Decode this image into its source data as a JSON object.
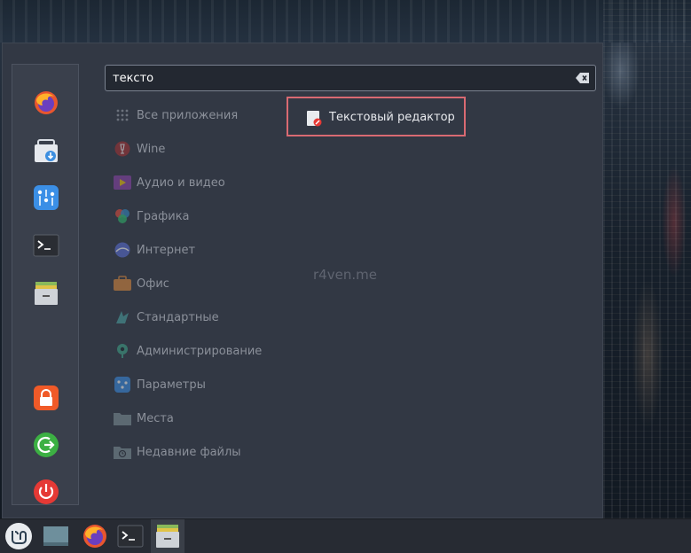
{
  "search": {
    "value": "тексто",
    "placeholder": ""
  },
  "categories": [
    {
      "label": "Все приложения",
      "icon": "grid-icon"
    },
    {
      "label": "Wine",
      "icon": "wine-icon"
    },
    {
      "label": "Аудио и видео",
      "icon": "multimedia-icon"
    },
    {
      "label": "Графика",
      "icon": "graphics-icon"
    },
    {
      "label": "Интернет",
      "icon": "internet-icon"
    },
    {
      "label": "Офис",
      "icon": "office-icon"
    },
    {
      "label": "Стандартные",
      "icon": "accessories-icon"
    },
    {
      "label": "Администрирование",
      "icon": "administration-icon"
    },
    {
      "label": "Параметры",
      "icon": "preferences-icon"
    },
    {
      "label": "Места",
      "icon": "folder-icon"
    },
    {
      "label": "Недавние файлы",
      "icon": "recent-files-icon"
    }
  ],
  "result": {
    "label": "Текстовый редактор",
    "icon": "text-editor-icon"
  },
  "watermark": "r4ven.me",
  "favorites": [
    "firefox-icon",
    "software-manager-icon",
    "settings-icon",
    "terminal-icon",
    "files-icon",
    "lock-icon",
    "logout-icon",
    "power-icon"
  ],
  "taskbar": [
    "mint-menu-icon",
    "show-desktop-icon",
    "firefox-icon",
    "terminal-icon",
    "files-icon"
  ],
  "colors": {
    "highlight": "#d96a72",
    "menu_bg": "#323844",
    "panel_bg": "#272b33"
  }
}
